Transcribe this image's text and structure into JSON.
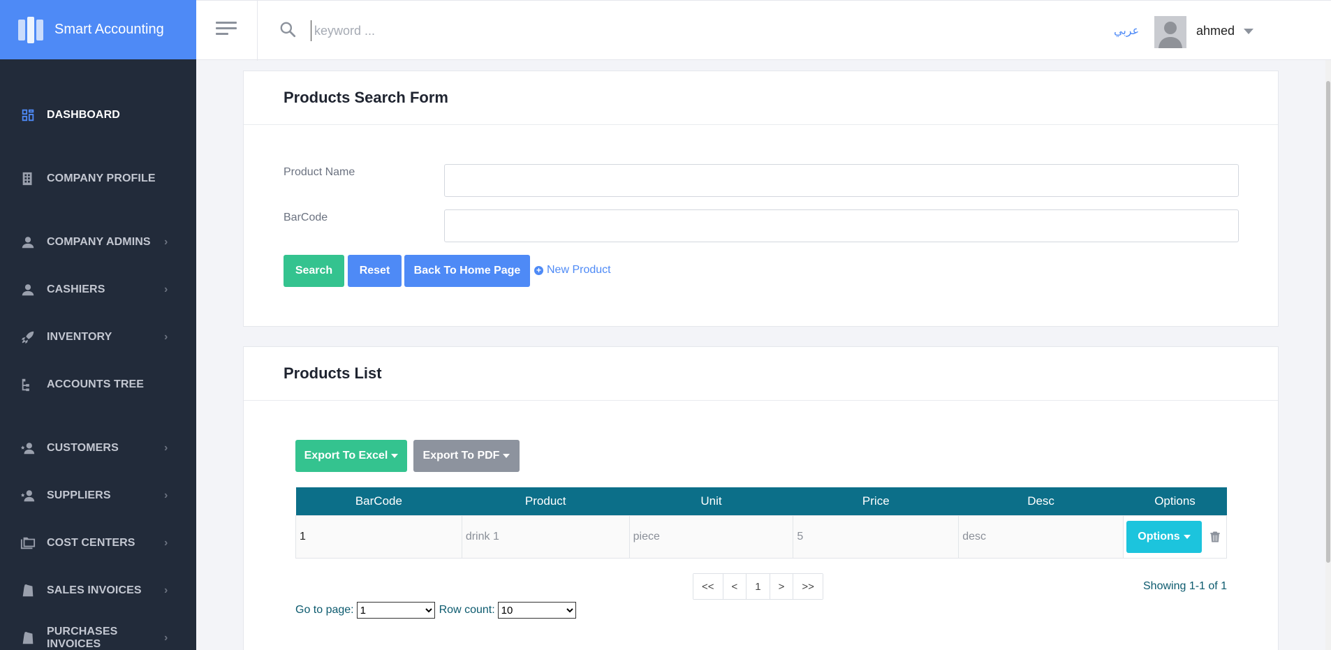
{
  "app": {
    "name": "Smart Accounting"
  },
  "sidebar": {
    "items": [
      {
        "label": "DASHBOARD",
        "icon": "dashboard-icon",
        "active": true,
        "chevron": false
      },
      {
        "label": "COMPANY PROFILE",
        "icon": "building-icon",
        "chevron": false
      },
      {
        "label": "COMPANY ADMINS",
        "icon": "person-icon",
        "chevron": true
      },
      {
        "label": "CASHIERS",
        "icon": "person-icon",
        "chevron": true
      },
      {
        "label": "INVENTORY",
        "icon": "rocket-icon",
        "chevron": true
      },
      {
        "label": "ACCOUNTS TREE",
        "icon": "tree-icon",
        "chevron": false
      },
      {
        "label": "CUSTOMERS",
        "icon": "person-star-icon",
        "chevron": true
      },
      {
        "label": "SUPPLIERS",
        "icon": "person-star-icon",
        "chevron": true
      },
      {
        "label": "COST CENTERS",
        "icon": "folders-icon",
        "chevron": true
      },
      {
        "label": "SALES INVOICES",
        "icon": "shopping-bag-icon",
        "chevron": true
      },
      {
        "label": "PURCHASES INVOICES",
        "icon": "shopping-bag-icon",
        "chevron": true
      }
    ]
  },
  "topbar": {
    "search_placeholder": "keyword ...",
    "language_link": "عربي",
    "user_name": "ahmed"
  },
  "search_form": {
    "title": "Products Search Form",
    "product_name_label": "Product Name",
    "product_name_value": "",
    "barcode_label": "BarCode",
    "barcode_value": "",
    "search_button": "Search",
    "reset_button": "Reset",
    "back_button": "Back To Home Page",
    "new_product_link": "New Product"
  },
  "products_list": {
    "title": "Products List",
    "export_excel": "Export To Excel",
    "export_pdf": "Export To PDF",
    "columns": [
      "BarCode",
      "Product",
      "Unit",
      "Price",
      "Desc",
      "Options"
    ],
    "rows": [
      {
        "barcode": "1",
        "product": "drink 1",
        "unit": "piece",
        "price": "5",
        "desc": "desc"
      }
    ],
    "row_options_button": "Options",
    "pagination": {
      "first": "<<",
      "prev": "<",
      "current": "1",
      "next": ">",
      "last": ">>"
    },
    "showing": "Showing 1-1 of 1",
    "goto_label": "Go to page:",
    "goto_value": "1",
    "row_count_label": "Row count:",
    "row_count_value": "10"
  },
  "colors": {
    "brand": "#4e8af6",
    "sidebar": "#222b3a",
    "table_header": "#0c6f89",
    "success": "#34c38f",
    "info": "#1cc4dd"
  }
}
